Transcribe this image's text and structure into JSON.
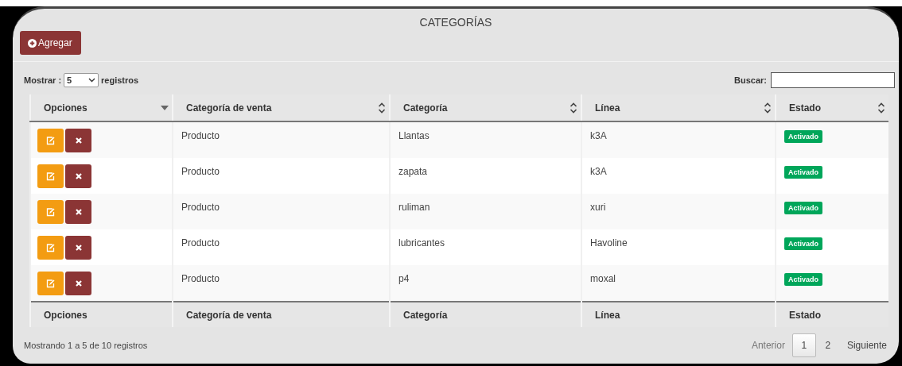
{
  "title": "CATEGORÍAS",
  "add_button": {
    "label": "Agregar"
  },
  "length": {
    "label_before": "Mostrar :",
    "value": "5",
    "label_after": "registros"
  },
  "search": {
    "label": "Buscar:"
  },
  "table": {
    "columns": [
      {
        "label": "Opciones",
        "sorted": true
      },
      {
        "label": "Categoría de venta",
        "sorted": false
      },
      {
        "label": "Categoría",
        "sorted": false
      },
      {
        "label": "Línea",
        "sorted": false
      },
      {
        "label": "Estado",
        "sorted": false
      }
    ],
    "rows": [
      {
        "sale_category": "Producto",
        "category": "Llantas",
        "line": "k3A",
        "status": "Activado",
        "active": true
      },
      {
        "sale_category": "Producto",
        "category": "zapata",
        "line": "k3A",
        "status": "Activado",
        "active": true
      },
      {
        "sale_category": "Producto",
        "category": "ruliman",
        "line": "xuri",
        "status": "Activado",
        "active": true
      },
      {
        "sale_category": "Producto",
        "category": "lubricantes",
        "line": "Havoline",
        "status": "Activado",
        "active": true
      },
      {
        "sale_category": "Producto",
        "category": "p4",
        "line": "moxal",
        "status": "Activado",
        "active": true
      }
    ],
    "footer": [
      "Opciones",
      "Categoría de venta",
      "Categoría",
      "Línea",
      "Estado"
    ]
  },
  "info": "Mostrando 1 a 5 de 10 registros",
  "pagination": {
    "previous": {
      "label": "Anterior",
      "disabled": true
    },
    "pages": [
      {
        "label": "1",
        "selected": true
      },
      {
        "label": "2",
        "selected": false
      }
    ],
    "next": {
      "label": "Siguiente",
      "disabled": false
    }
  }
}
